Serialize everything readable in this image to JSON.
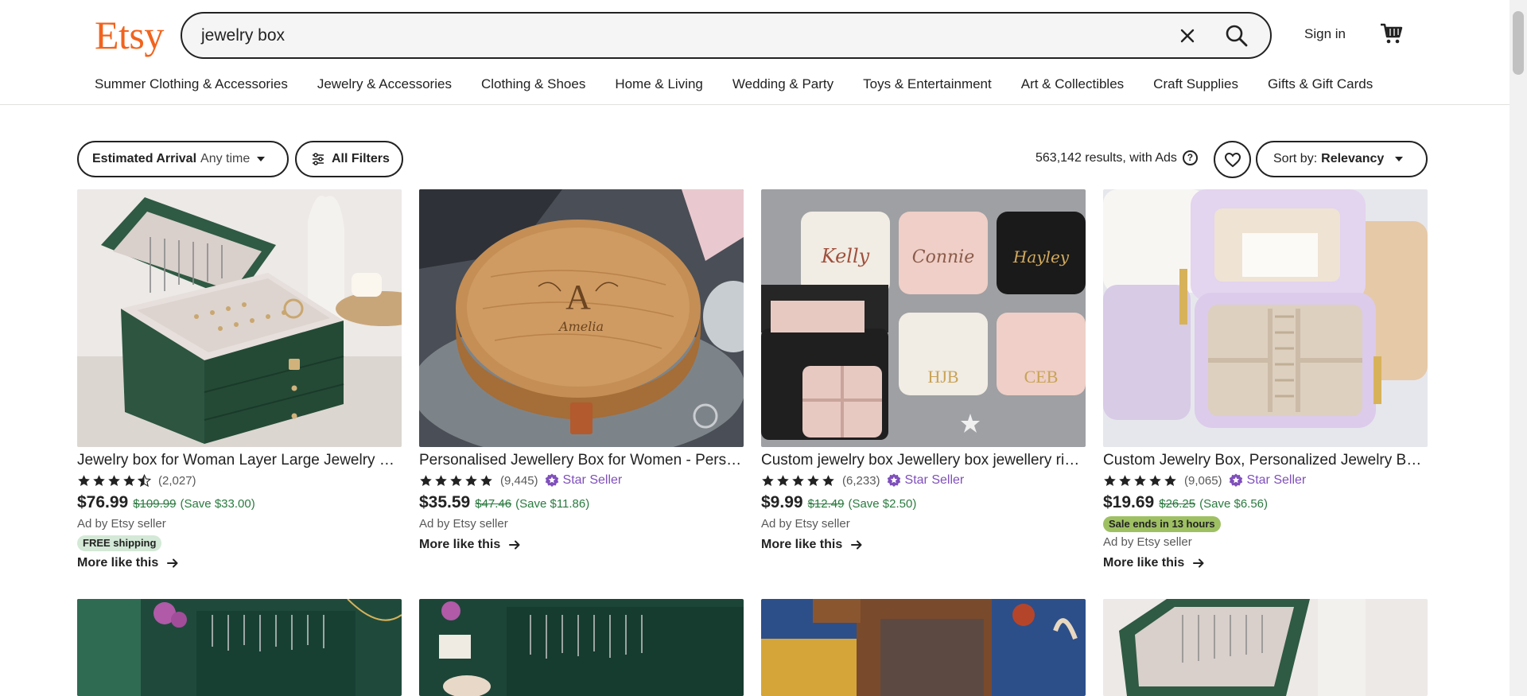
{
  "header": {
    "logo": "Etsy",
    "search_value": "jewelry box",
    "sign_in": "Sign in",
    "colors": {
      "logo": "#f1641e",
      "star_seller": "#7f4fbb",
      "savings": "#2a7a3f"
    }
  },
  "categories": [
    "Summer Clothing & Accessories",
    "Jewelry & Accessories",
    "Clothing & Shoes",
    "Home & Living",
    "Wedding & Party",
    "Toys & Entertainment",
    "Art & Collectibles",
    "Craft Supplies",
    "Gifts & Gift Cards"
  ],
  "filters": {
    "arrival_label": "Estimated Arrival",
    "arrival_value": "Any time",
    "all_filters": "All Filters",
    "results": "563,142 results, with Ads",
    "help": "?",
    "sort_label": "Sort by:",
    "sort_value": "Relevancy"
  },
  "products": [
    {
      "title": "Jewelry box for Woman Layer Large Jewelry Storage Box",
      "rating": 4.5,
      "reviews": "(2,027)",
      "star_seller": "",
      "price": "$76.99",
      "original": "$109.99",
      "save": "(Save $33.00)",
      "ad": "Ad by Etsy seller",
      "badge": "FREE shipping",
      "badge_type": "free",
      "more": "More like this"
    },
    {
      "title": "Personalised Jewellery Box for Women - Personalised Gift",
      "rating": 5,
      "reviews": "(9,445)",
      "star_seller": "Star Seller",
      "price": "$35.59",
      "original": "$47.46",
      "save": "(Save $11.86)",
      "ad": "Ad by Etsy seller",
      "badge": "",
      "badge_type": "",
      "more": "More like this"
    },
    {
      "title": "Custom jewelry box Jewellery box jewellery ring box",
      "rating": 5,
      "reviews": "(6,233)",
      "star_seller": "Star Seller",
      "price": "$9.99",
      "original": "$12.49",
      "save": "(Save $2.50)",
      "ad": "Ad by Etsy seller",
      "badge": "",
      "badge_type": "",
      "more": "More like this"
    },
    {
      "title": "Custom Jewelry Box, Personalized Jewelry Box, Travel Case",
      "rating": 5,
      "reviews": "(9,065)",
      "star_seller": "Star Seller",
      "price": "$19.69",
      "original": "$26.25",
      "save": "(Save $6.56)",
      "ad": "Ad by Etsy seller",
      "badge": "Sale ends in 13 hours",
      "badge_type": "sale",
      "more": "More like this"
    }
  ],
  "box_initials": [
    "HJB",
    "CEB"
  ],
  "box_names": [
    "Kelly",
    "Connie",
    "Hayley"
  ],
  "engraving_letter": "A",
  "engraving_name": "Amelia"
}
